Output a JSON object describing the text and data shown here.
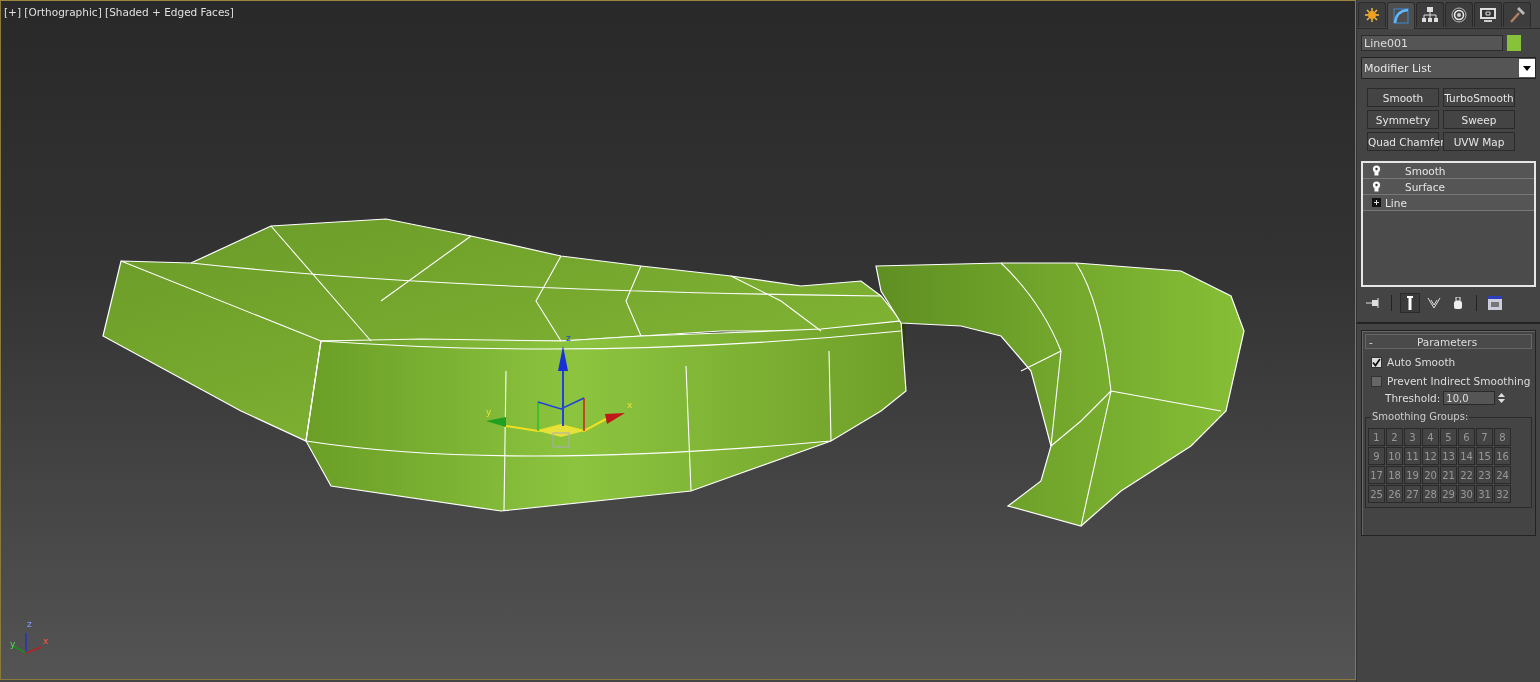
{
  "viewport": {
    "label": "[+] [Orthographic] [Shaded + Edged Faces]",
    "gizmo_axes": [
      {
        "kind": "z",
        "label": "z"
      },
      {
        "kind": "y",
        "label": "y"
      },
      {
        "kind": "x",
        "label": "x"
      }
    ],
    "corner_axes": [
      {
        "kind": "z",
        "label": "z"
      },
      {
        "kind": "y",
        "label": "y"
      },
      {
        "kind": "x",
        "label": "x"
      }
    ]
  },
  "command_panel": {
    "tabs": [
      {
        "kind": "create",
        "selected": false
      },
      {
        "kind": "modify",
        "selected": true
      },
      {
        "kind": "hierarchy",
        "selected": false
      },
      {
        "kind": "motion",
        "selected": false
      },
      {
        "kind": "display",
        "selected": false
      },
      {
        "kind": "utilities",
        "selected": false
      }
    ],
    "object": {
      "name": "Line001",
      "color": "#86c23a"
    },
    "modifier_list": "Modifier List",
    "modifier_buttons": [
      "Smooth",
      "TurboSmooth",
      "Symmetry",
      "Sweep",
      "Quad Chamfer",
      "UVW Map"
    ],
    "stack": [
      {
        "kind": "modifier",
        "label": "Smooth"
      },
      {
        "kind": "modifier",
        "label": "Surface"
      },
      {
        "kind": "base",
        "label": "Line"
      }
    ],
    "stack_tools": [
      {
        "kind": "pin",
        "selected": false
      },
      {
        "kind": "show-end",
        "selected": true
      },
      {
        "kind": "unique",
        "selected": false
      },
      {
        "kind": "remove",
        "selected": false
      },
      {
        "kind": "configure",
        "selected": false
      }
    ],
    "parameters": {
      "toggle": "-",
      "title": "Parameters",
      "options": [
        {
          "label": "Auto Smooth",
          "checked": true
        },
        {
          "label": "Prevent Indirect Smoothing",
          "checked": false
        }
      ],
      "threshold_label": "Threshold:",
      "threshold_value": "10,0",
      "groups_title": "Smoothing Groups:",
      "groups": [
        "1",
        "2",
        "3",
        "4",
        "5",
        "6",
        "7",
        "8",
        "9",
        "10",
        "11",
        "12",
        "13",
        "14",
        "15",
        "16",
        "17",
        "18",
        "19",
        "20",
        "21",
        "22",
        "23",
        "24",
        "25",
        "26",
        "27",
        "28",
        "29",
        "30",
        "31",
        "32"
      ]
    }
  }
}
